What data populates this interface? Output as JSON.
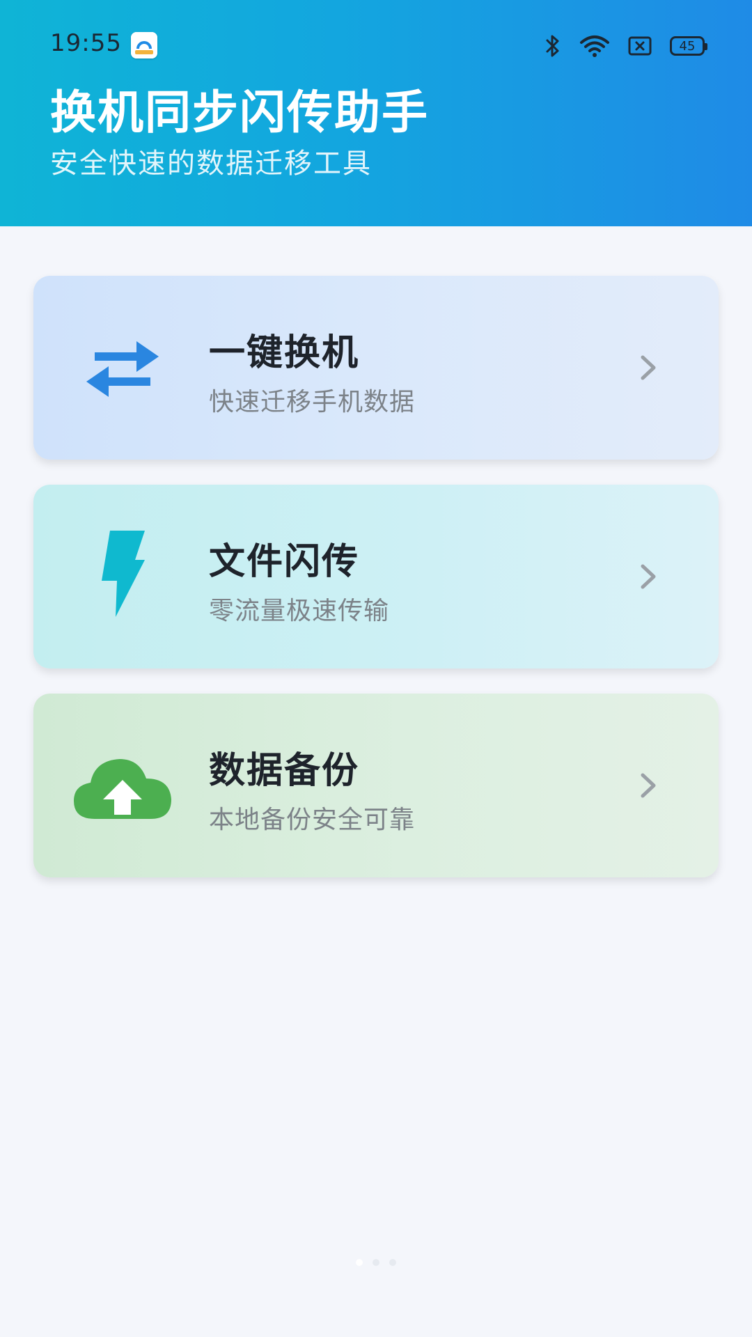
{
  "status_bar": {
    "time": "19:55",
    "battery": "45"
  },
  "header": {
    "title": "换机同步闪传助手",
    "subtitle": "安全快速的数据迁移工具"
  },
  "cards": [
    {
      "title": "一键换机",
      "subtitle": "快速迁移手机数据",
      "icon": "swap-arrows-icon",
      "color": "#2a86e0"
    },
    {
      "title": "文件闪传",
      "subtitle": "零流量极速传输",
      "icon": "lightning-bolt-icon",
      "color": "#0fb9cf"
    },
    {
      "title": "数据备份",
      "subtitle": "本地备份安全可靠",
      "icon": "cloud-upload-icon",
      "color": "#4caf50"
    }
  ],
  "colors": {
    "header_start": "#0fb4d6",
    "header_end": "#1f8be6",
    "background": "#f4f6fb"
  }
}
